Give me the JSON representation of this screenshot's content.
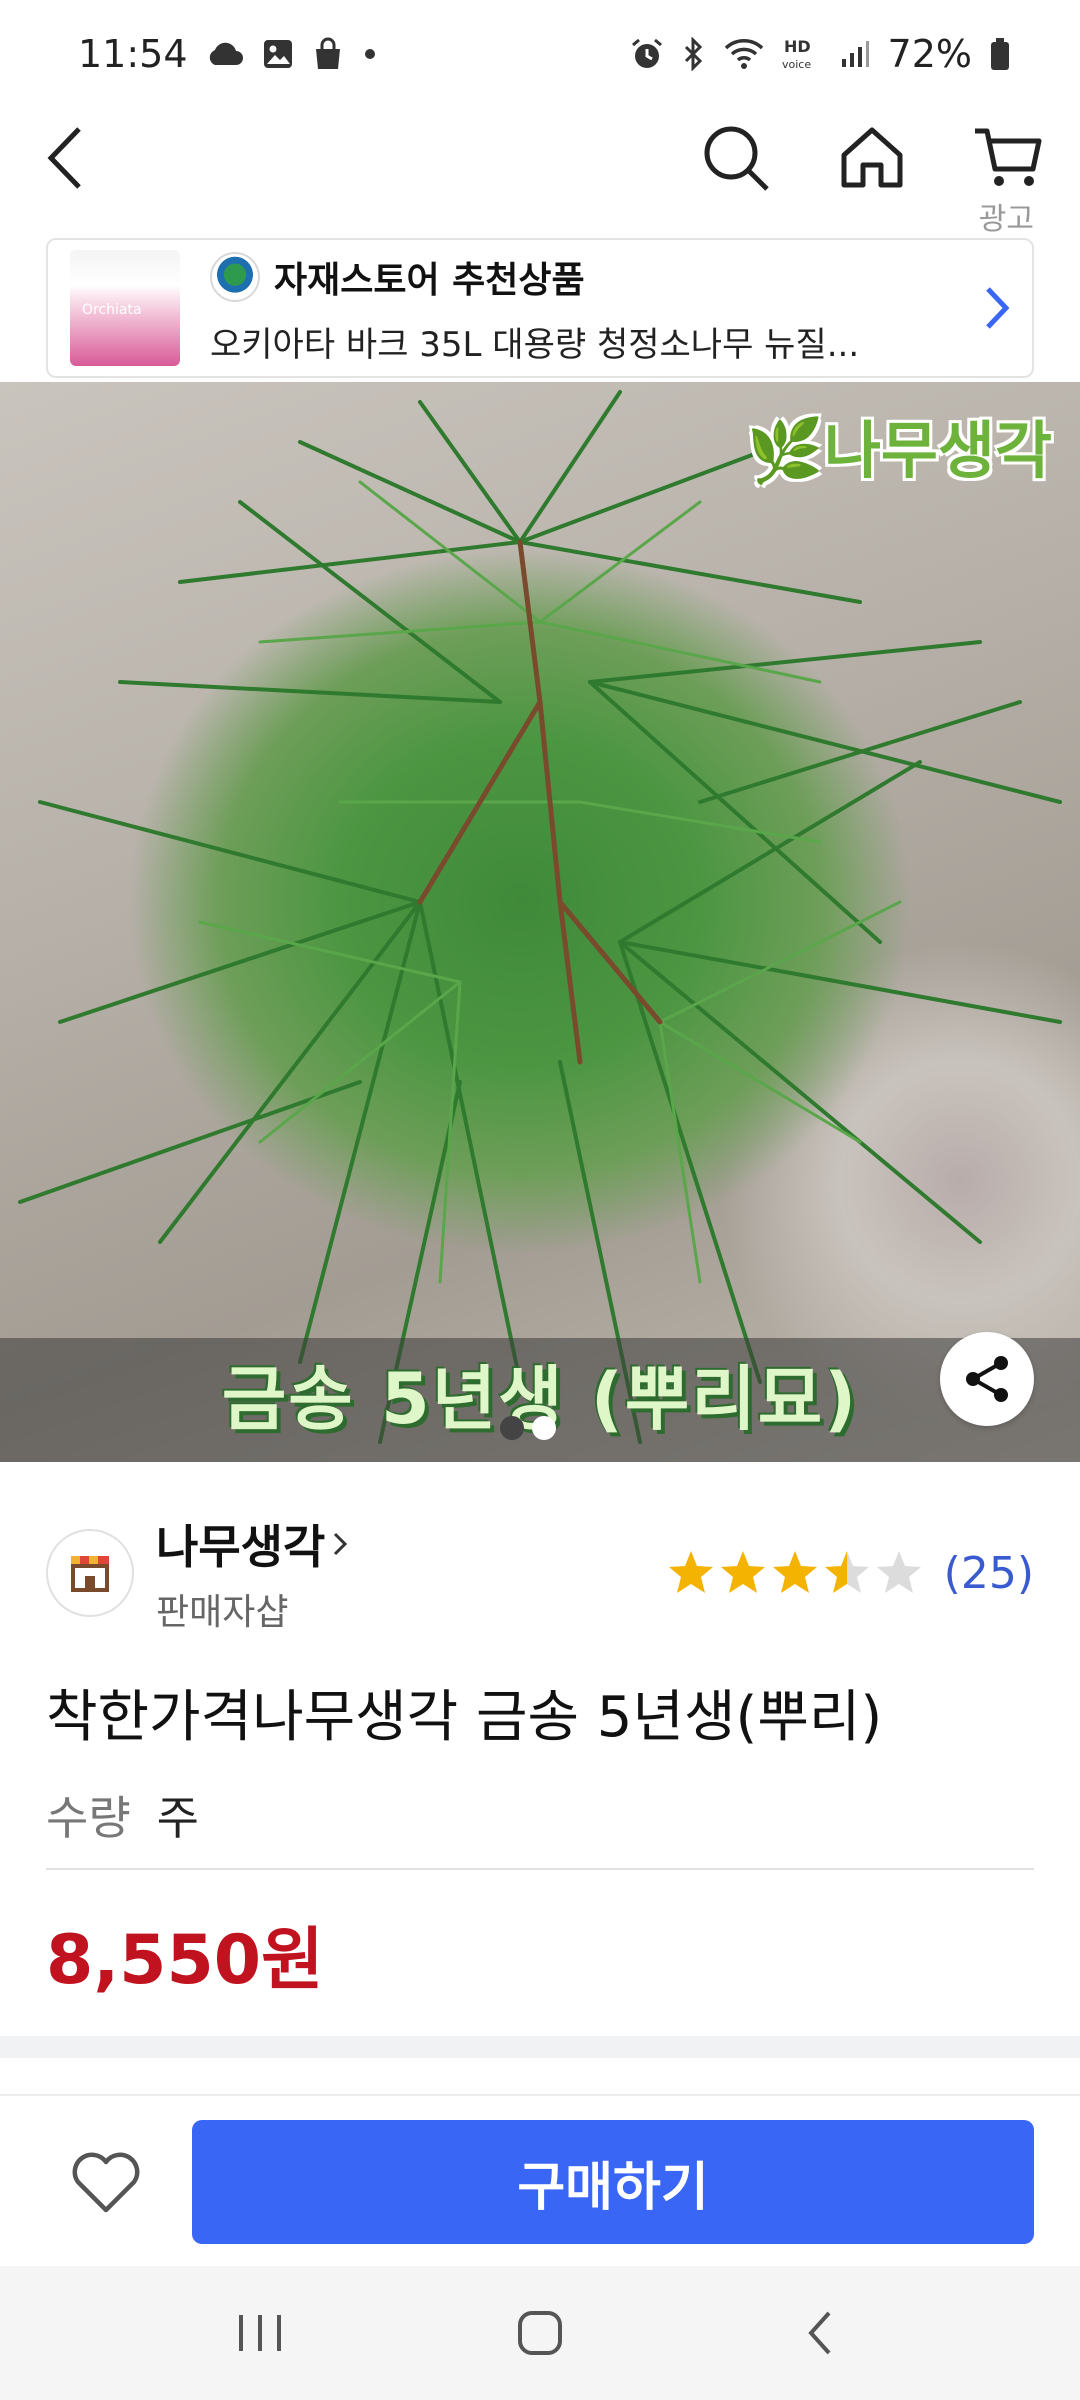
{
  "status_bar": {
    "time": "11:54",
    "battery": "72%",
    "left_icons": [
      "cloud-icon",
      "image-icon",
      "shopping-bag-icon",
      "dot-icon"
    ],
    "right_icons": [
      "alarm-icon",
      "bluetooth-icon",
      "wifi-icon",
      "hd-voice-icon",
      "signal-icon",
      "battery-icon"
    ],
    "hd_voice": "HD voice"
  },
  "nav": {
    "icons": [
      "back-icon",
      "search-icon",
      "home-icon",
      "cart-icon"
    ],
    "ad_label": "광고"
  },
  "ad_banner": {
    "store_name": "자재스토어 추천상품",
    "title": "오키아타 바크 35L 대용량 청정소나무 뉴질...",
    "thumb_text": "Orchiata"
  },
  "product_image": {
    "watermark": "🌿나무생각",
    "caption": "금송 5년생 (뿌리묘)",
    "page_count": 2,
    "active_page": 1
  },
  "seller": {
    "name": "나무생각",
    "subtitle": "판매자샵",
    "rating": 3.5,
    "rating_count": "(25)"
  },
  "product": {
    "title": "착한가격나무생각 금송 5년생(뿌리)",
    "quantity_label": "수량",
    "quantity_unit": "주",
    "price": "8,550원"
  },
  "actions": {
    "buy_label": "구매하기"
  },
  "colors": {
    "accent": "#3a66f5",
    "price": "#c1121f",
    "rating_star": "#f5b301",
    "rating_count": "#3a5bd0"
  }
}
